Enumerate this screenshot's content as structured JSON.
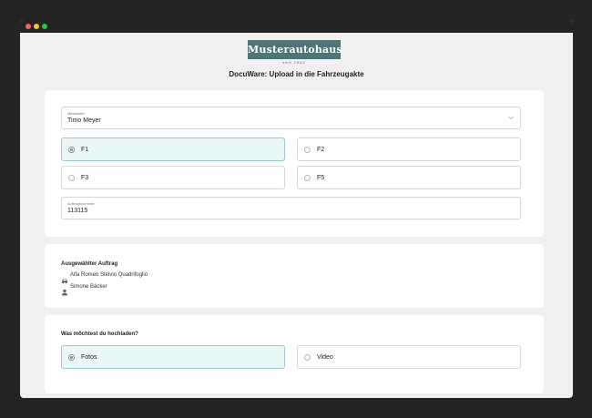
{
  "header": {
    "logo_text": "Musterautohaus",
    "logo_sub": "seit 1962",
    "title": "DocuWare: Upload in die Fahrzeugakte"
  },
  "form": {
    "employee_label": "Mitarbeiter",
    "employee_value": "Timo Meyer",
    "options": [
      {
        "label": "F1",
        "selected": true
      },
      {
        "label": "F2",
        "selected": false
      },
      {
        "label": "F3",
        "selected": false
      },
      {
        "label": "F5",
        "selected": false
      }
    ],
    "order_label": "Auftragsnummer",
    "order_value": "113115"
  },
  "selected_order": {
    "title": "Ausgewählter Auftrag",
    "car": "Alfa Romeo Stelvio Quadrifoglio",
    "person": "Simone Bäcker"
  },
  "upload": {
    "title": "Was möchtest du hochladen?",
    "options": [
      {
        "label": "Fotos",
        "selected": true
      },
      {
        "label": "Video",
        "selected": false
      }
    ]
  },
  "colors": {
    "brand": "#4f7478",
    "selected_bg": "#eaf7f7"
  }
}
